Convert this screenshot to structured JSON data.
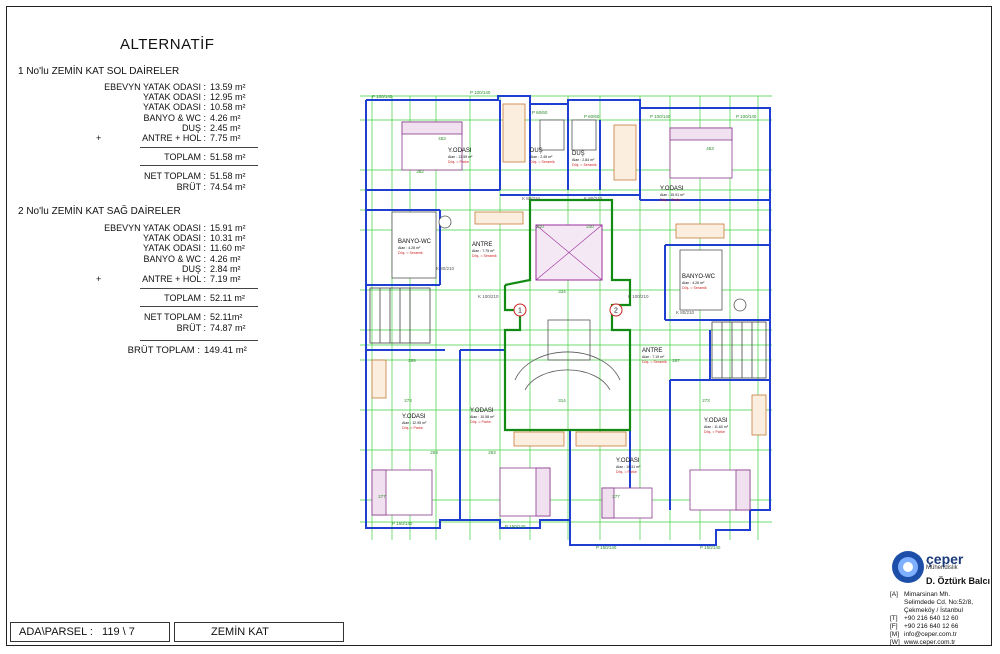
{
  "title": "ALTERNATİF",
  "units": [
    {
      "heading": "1  No'lu ZEMİN KAT SOL DAİRELER",
      "rooms": [
        {
          "label": "EBEVYN YATAK ODASI :",
          "value": "13.59 m²"
        },
        {
          "label": "YATAK ODASI :",
          "value": "12.95 m²"
        },
        {
          "label": "YATAK ODASI :",
          "value": "10.58 m²"
        },
        {
          "label": "BANYO & WC :",
          "value": "4.26 m²"
        },
        {
          "label": "DUŞ :",
          "value": "2.45 m²"
        },
        {
          "label": "ANTRE + HOL :",
          "value": "7.75 m²"
        }
      ],
      "plus": "+",
      "total_label": "TOPLAM :",
      "total_value": "51.58 m²",
      "net_label": "NET TOPLAM :",
      "net_value": "51.58 m²",
      "gross_label": "BRÜT :",
      "gross_value": "74.54 m²"
    },
    {
      "heading": "2  No'lu ZEMİN KAT SAĞ DAİRELER",
      "rooms": [
        {
          "label": "EBEVYN YATAK ODASI :",
          "value": "15.91 m²"
        },
        {
          "label": "YATAK ODASI :",
          "value": "10.31 m²"
        },
        {
          "label": "YATAK ODASI :",
          "value": "11.60 m²"
        },
        {
          "label": "BANYO & WC :",
          "value": "4.26 m²"
        },
        {
          "label": "DUŞ :",
          "value": "2.84 m²"
        },
        {
          "label": "ANTRE + HOL :",
          "value": "7.19 m²"
        }
      ],
      "plus": "+",
      "total_label": "TOPLAM :",
      "total_value": "52.11 m²",
      "net_label": "NET TOPLAM :",
      "net_value": "52.11m²",
      "gross_label": "BRÜT :",
      "gross_value": "74.87 m²"
    }
  ],
  "gross_total_label": "BRÜT TOPLAM :",
  "gross_total_value": "149.41 m²",
  "parcel_label": "ADA\\PARSEL :",
  "parcel_value": "119 \\ 7",
  "floor_name": "ZEMİN KAT",
  "plan": {
    "rooms": [
      {
        "name": "Y.ODASI",
        "area": "Alan : 13.59 m²",
        "spec": "Döş. = Parke"
      },
      {
        "name": "DUŞ",
        "area": "Alan : 2.45 m²",
        "spec": "Döş. = Seramik"
      },
      {
        "name": "DUŞ",
        "area": "Alan : 2.84 m²",
        "spec": "Döş. = Seramik"
      },
      {
        "name": "Y.ODASI",
        "area": "Alan : 15.91 m²",
        "spec": "Döş. = Parke"
      },
      {
        "name": "BANYO-WC",
        "area": "Alan : 4.26 m²",
        "spec": "Döş. = Seramik"
      },
      {
        "name": "ANTRE",
        "area": "Alan : 7.75 m²",
        "spec": "Döş. = Seramik"
      },
      {
        "name": "BANYO-WC",
        "area": "Alan : 4.26 m²",
        "spec": "Döş. = Seramik"
      },
      {
        "name": "ANTRE",
        "area": "Alan : 7.19 m²",
        "spec": "Döş. = Seramik"
      },
      {
        "name": "Y.ODASI",
        "area": "Alan : 12.95 m²",
        "spec": "Döş. = Parke"
      },
      {
        "name": "Y.ODASI",
        "area": "Alan : 10.58 m²",
        "spec": "Döş. = Parke"
      },
      {
        "name": "Y.ODASI",
        "area": "Alan : 10.31 m²",
        "spec": "Döş. = Parke"
      },
      {
        "name": "Y.ODASI",
        "area": "Alan : 11.60 m²",
        "spec": "Döş. = Parke"
      }
    ],
    "unit_marks": [
      "1",
      "2"
    ],
    "doors": [
      "K 100/210",
      "K 100/210",
      "K 80/210",
      "K 80/210",
      "K 80/210",
      "K 80/210"
    ],
    "windows": [
      "P 100/140",
      "P 100/140",
      "P 60/60",
      "P 60/60",
      "P 100/140",
      "P 100/140",
      "P 150/140",
      "P 150/140",
      "P 150/140",
      "P 150/140"
    ],
    "dims": [
      "453",
      "453",
      "382",
      "210",
      "210",
      "334",
      "289",
      "287",
      "273",
      "273",
      "314",
      "277",
      "277",
      "263",
      "263"
    ]
  },
  "logo": {
    "brand": "çeper",
    "sub": "Mühendislik",
    "owner": "D. Öztürk Balcı",
    "lines": [
      {
        "k": "[A]",
        "v": "Mimarsinan Mh."
      },
      {
        "k": "",
        "v": "Selimdede Cd. No:52/8,"
      },
      {
        "k": "",
        "v": "Çekmeköy / İstanbul"
      },
      {
        "k": "[T]",
        "v": "+90 216 640 12 60"
      },
      {
        "k": "[F]",
        "v": "+90 216 640 12 66"
      },
      {
        "k": "[M]",
        "v": "info@ceper.com.tr"
      },
      {
        "k": "[W]",
        "v": "www.ceper.com.tr"
      }
    ]
  }
}
